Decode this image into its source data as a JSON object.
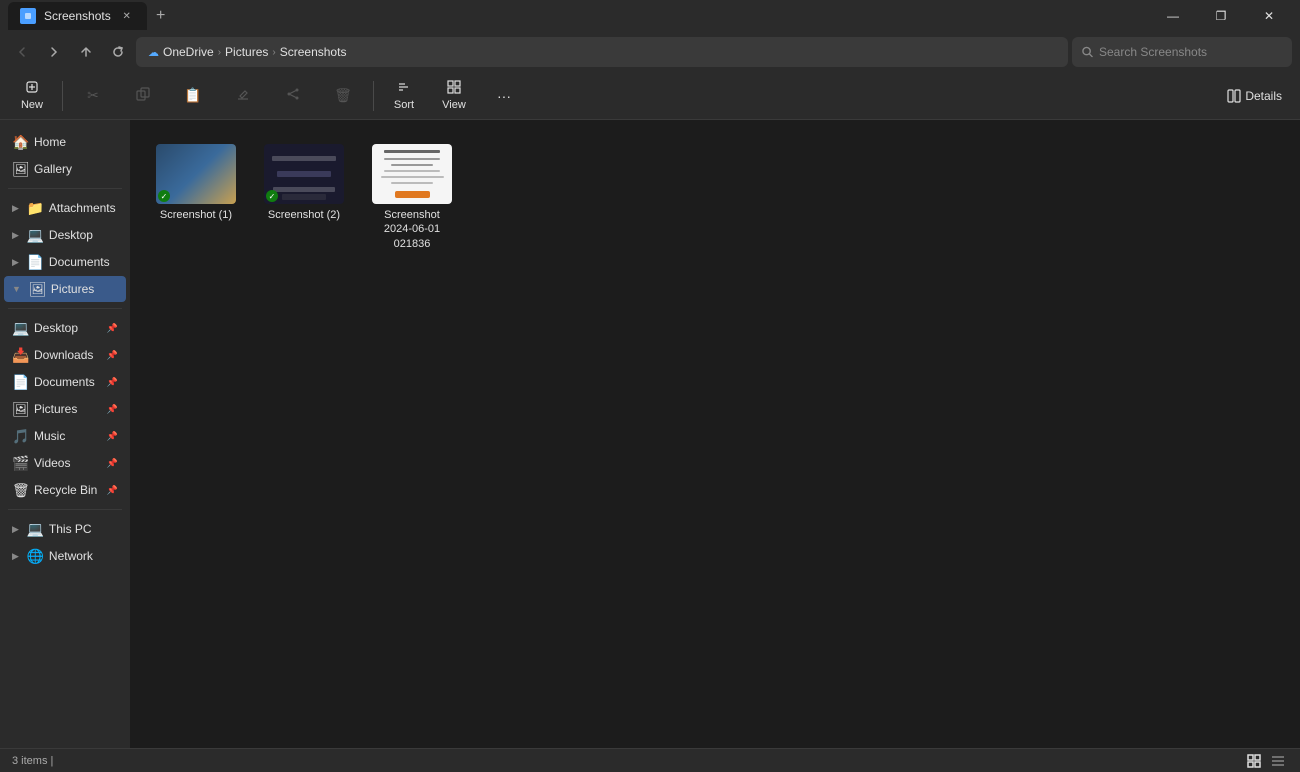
{
  "titlebar": {
    "tab_title": "Screenshots",
    "new_tab_tooltip": "New tab",
    "minimize_label": "—",
    "maximize_label": "❐",
    "close_label": "✕"
  },
  "addressbar": {
    "back_label": "‹",
    "forward_label": "›",
    "up_label": "↑",
    "refresh_label": "↻",
    "breadcrumb": {
      "cloud": "☁",
      "part1": "OneDrive",
      "sep1": "›",
      "part2": "Pictures",
      "sep2": "›",
      "part3": "Screenshots"
    },
    "search_placeholder": "Search Screenshots"
  },
  "toolbar": {
    "new_label": "New",
    "cut_label": "Cut",
    "copy_label": "Copy",
    "paste_label": "Paste",
    "rename_label": "Rename",
    "share_label": "Share",
    "delete_label": "Delete",
    "sort_label": "Sort",
    "view_label": "View",
    "more_label": "···",
    "details_label": "Details"
  },
  "sidebar": {
    "sections": {
      "top": [
        {
          "id": "home",
          "icon": "🏠",
          "label": "Home",
          "expandable": false,
          "pinnable": false
        },
        {
          "id": "gallery",
          "icon": "🖼",
          "label": "Gallery",
          "expandable": false,
          "pinnable": false
        }
      ],
      "favorites": [
        {
          "id": "attachments",
          "icon": "📁",
          "label": "Attachments",
          "expandable": true,
          "pinnable": false,
          "color": "#f0b832"
        },
        {
          "id": "desktop-fav",
          "icon": "💻",
          "label": "Desktop",
          "expandable": true,
          "pinnable": false,
          "color": "#4a9eff"
        },
        {
          "id": "documents-fav",
          "icon": "📄",
          "label": "Documents",
          "expandable": true,
          "pinnable": false,
          "color": "#4a9eff"
        },
        {
          "id": "pictures-fav",
          "icon": "🖼",
          "label": "Pictures",
          "expandable": true,
          "pinnable": false,
          "active": true,
          "color": "#ff7a3d"
        }
      ],
      "quick": [
        {
          "id": "desktop",
          "icon": "💻",
          "label": "Desktop",
          "pinned": true,
          "color": "#4a9eff"
        },
        {
          "id": "downloads",
          "icon": "📥",
          "label": "Downloads",
          "pinned": true,
          "color": "#4a9eff"
        },
        {
          "id": "documents",
          "icon": "📄",
          "label": "Documents",
          "pinned": true,
          "color": "#4a9eff"
        },
        {
          "id": "pictures",
          "icon": "🖼",
          "label": "Pictures",
          "pinned": true,
          "color": "#ff7a3d"
        },
        {
          "id": "music",
          "icon": "🎵",
          "label": "Music",
          "pinned": true,
          "color": "#e85555"
        },
        {
          "id": "videos",
          "icon": "🎬",
          "label": "Videos",
          "pinned": true,
          "color": "#9b59b6"
        },
        {
          "id": "recycle",
          "icon": "🗑",
          "label": "Recycle Bin",
          "pinned": true,
          "color": "#888"
        }
      ],
      "system": [
        {
          "id": "thispc",
          "icon": "💻",
          "label": "This PC",
          "expandable": true,
          "color": "#4a9eff"
        },
        {
          "id": "network",
          "icon": "🌐",
          "label": "Network",
          "expandable": true,
          "color": "#4a9eff"
        }
      ]
    }
  },
  "files": [
    {
      "id": "screenshot1",
      "name": "Screenshot (1)",
      "type": "screenshot1",
      "synced": true
    },
    {
      "id": "screenshot2",
      "name": "Screenshot (2)",
      "type": "screenshot2",
      "synced": true
    },
    {
      "id": "screenshot3",
      "name": "Screenshot\n2024-06-01\n021836",
      "type": "screenshot3",
      "synced": false
    }
  ],
  "statusbar": {
    "item_count": "3 items",
    "cursor": "|"
  }
}
